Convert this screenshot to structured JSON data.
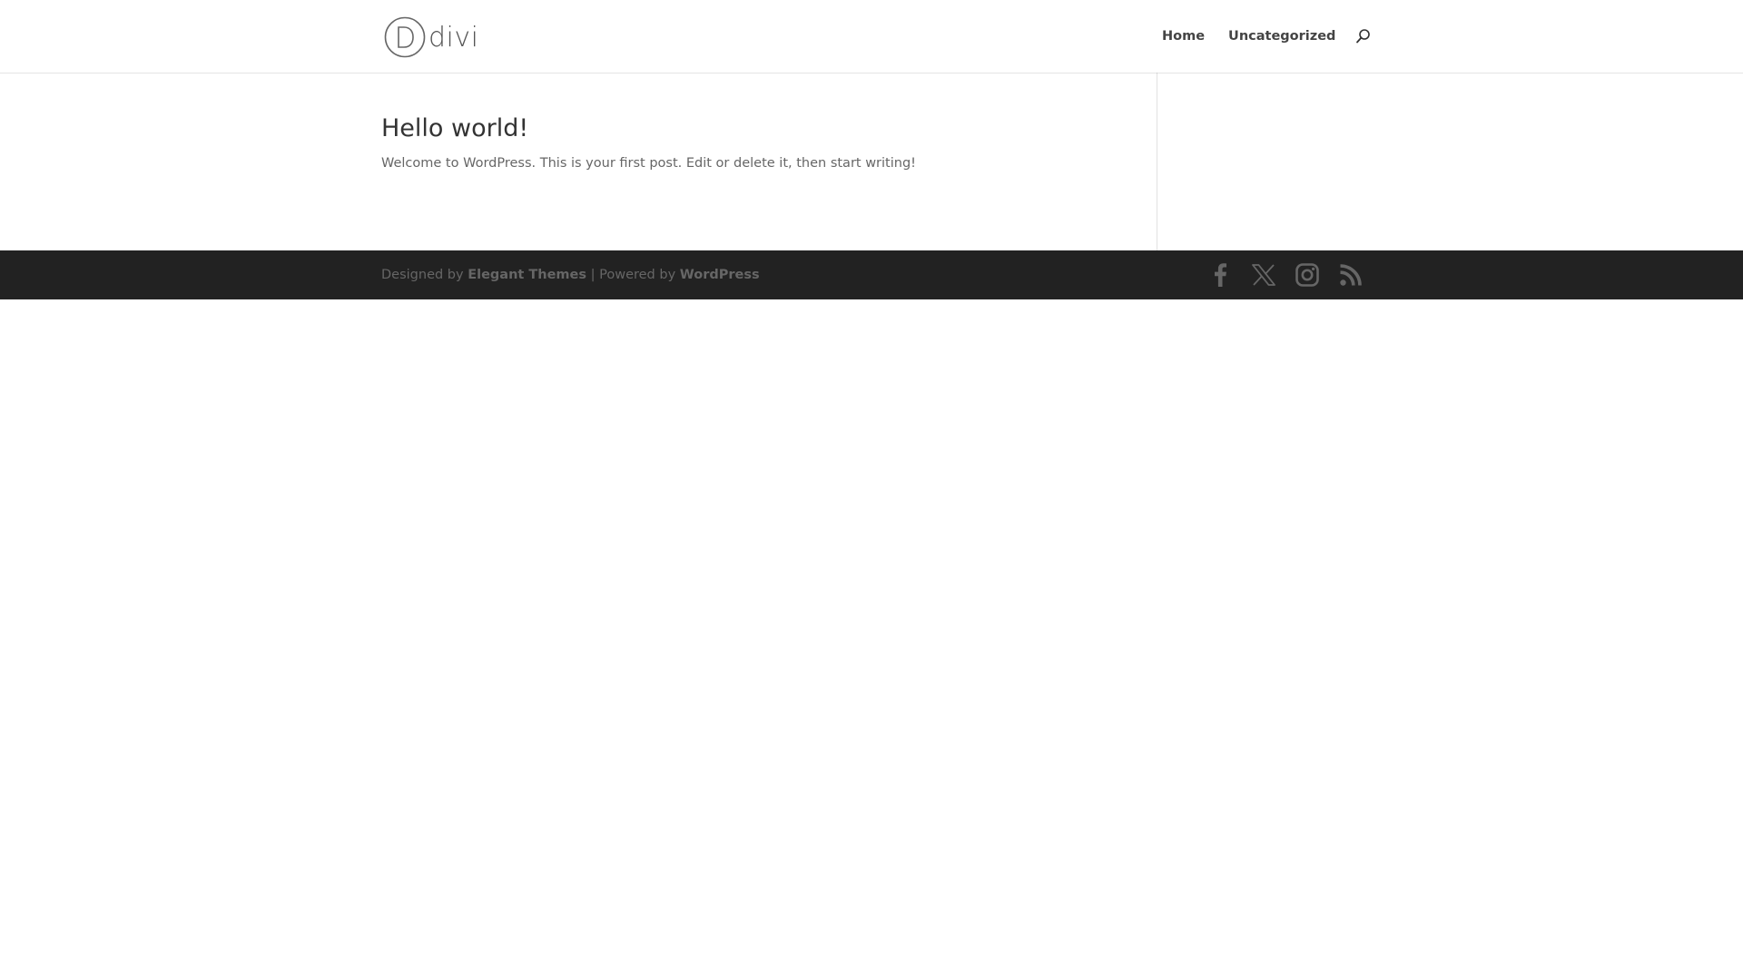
{
  "header": {
    "logo_text": "divi",
    "nav": [
      {
        "label": "Home"
      },
      {
        "label": "Uncategorized"
      }
    ],
    "search_icon": "search-icon"
  },
  "post": {
    "title": "Hello world!",
    "excerpt": "Welcome to WordPress. This is your first post. Edit or delete it, then start writing!"
  },
  "footer": {
    "credits": {
      "designed_by": "Designed by",
      "designer": "Elegant Themes",
      "separator": "| Powered by",
      "platform": "WordPress"
    },
    "social_icons": [
      "facebook-icon",
      "x-icon",
      "instagram-icon",
      "rss-icon"
    ]
  },
  "colors": {
    "footer_bg": "#222222",
    "text": "#666666",
    "title": "#333333"
  }
}
